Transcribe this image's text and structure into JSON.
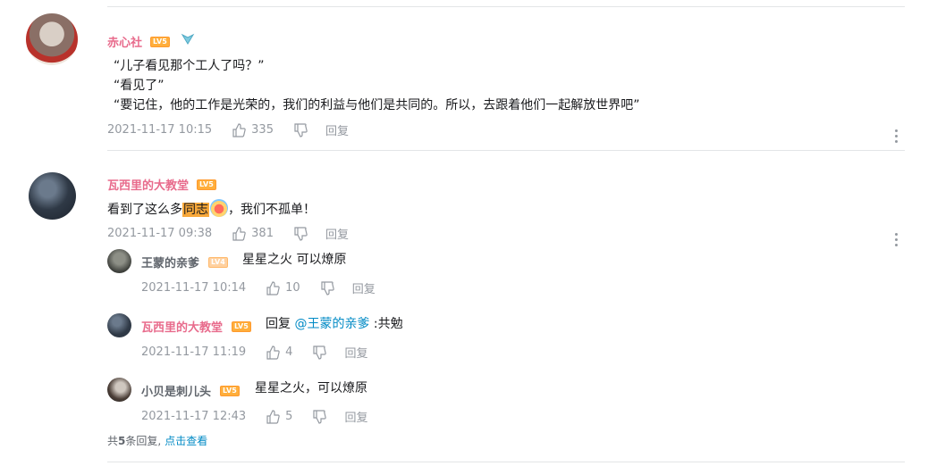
{
  "comments": [
    {
      "user": "赤心社",
      "level": "LV5",
      "lines": [
        "“儿子看见那个工人了吗？”",
        "“看见了”",
        "“要记住，他的工作是光荣的，我们的利益与他们是共同的。所以，去跟着他们一起解放世界吧”"
      ],
      "time": "2021-11-17 10:15",
      "likes": "335",
      "reply_label": "回复"
    },
    {
      "user": "瓦西里的大教堂",
      "level": "LV5",
      "text_before": "看到了这么多",
      "highlight": "同志",
      "text_after": "，我们不孤单！",
      "time": "2021-11-17 09:38",
      "likes": "381",
      "reply_label": "回复",
      "replies": [
        {
          "user": "王蒙的亲爹",
          "level": "LV4",
          "text": "星星之火 可以燎原",
          "time": "2021-11-17 10:14",
          "likes": "10",
          "reply_label": "回复"
        },
        {
          "user": "瓦西里的大教堂",
          "level": "LV5",
          "prefix": "回复",
          "mention": "@王蒙的亲爹",
          "text": ":共勉",
          "time": "2021-11-17 11:19",
          "likes": "4",
          "reply_label": "回复"
        },
        {
          "user": "小贝是刺儿头",
          "level": "LV5",
          "text": "星星之火，可以燎原",
          "time": "2021-11-17 12:43",
          "likes": "5",
          "reply_label": "回复"
        }
      ],
      "total_prefix": "共",
      "total_count": "5",
      "total_suffix": "条回复,",
      "view_more": "点击查看"
    }
  ],
  "colors": {
    "username": "#e86b8c",
    "link": "#008ac5",
    "meta": "#9499a0",
    "highlight": "#f8a83a"
  },
  "icons": {
    "like": "thumbs-up-icon",
    "dislike": "thumbs-down-icon",
    "more": "more-vertical-icon"
  }
}
